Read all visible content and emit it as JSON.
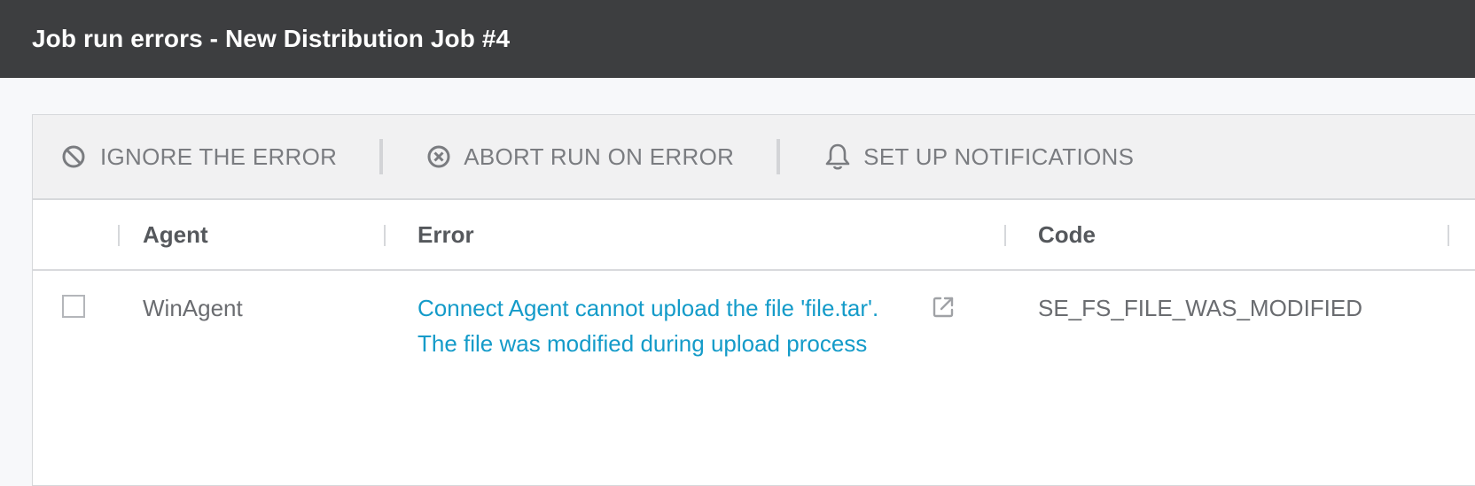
{
  "header": {
    "title": "Job run errors - New Distribution Job #4"
  },
  "toolbar": {
    "ignore_label": "IGNORE THE ERROR",
    "abort_label": "ABORT RUN ON ERROR",
    "notify_label": "SET UP NOTIFICATIONS",
    "icons": [
      "prohibited-icon",
      "x-circle-icon",
      "bell-icon"
    ]
  },
  "table": {
    "columns": [
      "Agent",
      "Error",
      "Code"
    ],
    "rows": [
      {
        "checked": false,
        "agent": "WinAgent",
        "error_line1": "Connect Agent cannot upload the file 'file.tar'.",
        "error_line2": "The file was modified during upload process",
        "code": "SE_FS_FILE_WAS_MODIFIED",
        "icon": "external-link-icon"
      }
    ]
  },
  "colors": {
    "header_bg": "#3d3e40",
    "link": "#149bc9",
    "toolbar_bg": "#f1f1f2",
    "muted_text": "#7a7c80"
  }
}
